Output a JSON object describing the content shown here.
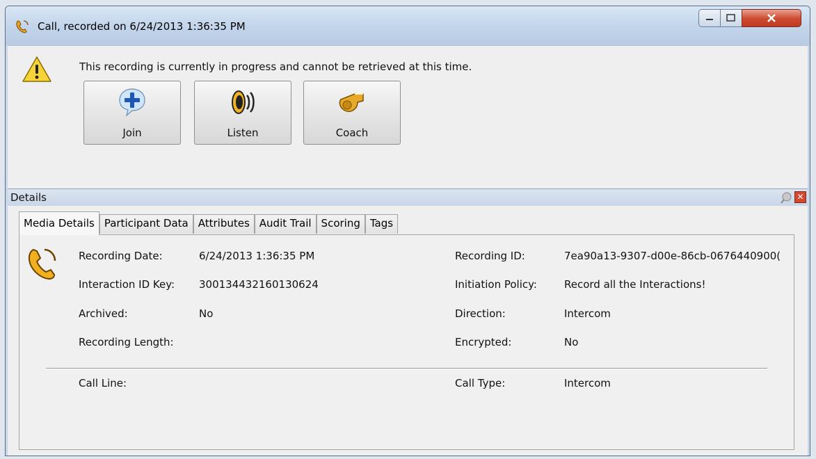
{
  "window": {
    "title": "Call,  recorded on 6/24/2013 1:36:35 PM"
  },
  "notice": {
    "message": "This recording is currently in progress and cannot be retrieved at this time."
  },
  "actions": [
    {
      "label": "Join",
      "icon": "join-plus-icon"
    },
    {
      "label": "Listen",
      "icon": "speaker-icon"
    },
    {
      "label": "Coach",
      "icon": "whistle-icon"
    }
  ],
  "details": {
    "title": "Details",
    "tabs": [
      "Media Details",
      "Participant Data",
      "Attributes",
      "Audit Trail",
      "Scoring",
      "Tags"
    ],
    "active_tab": "Media Details",
    "left_fields": [
      {
        "label": "Recording Date:",
        "value": "6/24/2013 1:36:35 PM"
      },
      {
        "label": "Interaction ID Key:",
        "value": "300134432160130624"
      },
      {
        "label": "Archived:",
        "value": "No"
      },
      {
        "label": "Recording Length:",
        "value": ""
      }
    ],
    "right_fields": [
      {
        "label": "Recording ID:",
        "value": "7ea90a13-9307-d00e-86cb-0676440900("
      },
      {
        "label": "Initiation Policy:",
        "value": "Record all the Interactions!"
      },
      {
        "label": "Direction:",
        "value": "Intercom"
      },
      {
        "label": "Encrypted:",
        "value": "No"
      }
    ],
    "bottom_left": {
      "label": "Call Line:",
      "value": ""
    },
    "bottom_right": {
      "label": "Call Type:",
      "value": "Intercom"
    }
  }
}
